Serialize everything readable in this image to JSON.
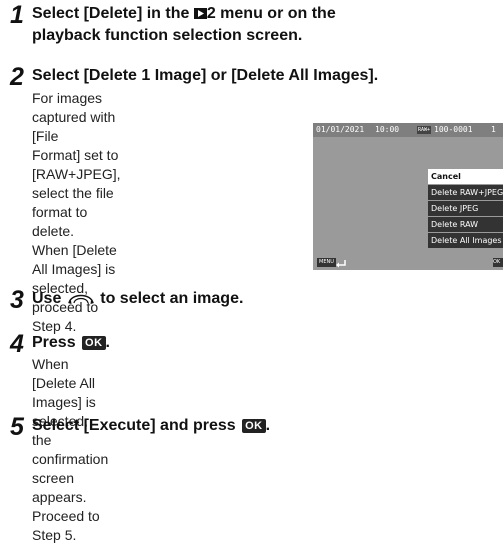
{
  "steps": [
    {
      "number": "1",
      "title_line1_a": "Select [Delete] in the ",
      "title_line1_b": "2 menu or on the",
      "title_line2": "playback function selection screen."
    },
    {
      "number": "2",
      "title": "Select [Delete 1 Image] or [Delete All Images].",
      "body": [
        "For images captured with [File",
        "Format] set to [RAW+JPEG],",
        "select the file format to delete.",
        "When [Delete All Images] is",
        "selected, proceed to Step 4."
      ]
    },
    {
      "number": "3",
      "title_a": "Use ",
      "title_b": " to select an image."
    },
    {
      "number": "4",
      "title": "Press ",
      "ok": "OK",
      "title_end": ".",
      "body": [
        "When [Delete All Images] is selected, the confirmation",
        "screen appears. Proceed to Step 5."
      ]
    },
    {
      "number": "5",
      "title": "Select [Execute] and press ",
      "ok": "OK",
      "title_end": "."
    }
  ],
  "screen": {
    "date": "01/01/2021",
    "time": "10:00",
    "file_badge": "RAW+",
    "file_number": "100-0001",
    "counter": "1",
    "menu": [
      "Cancel",
      "Delete RAW+JPEG",
      "Delete JPEG",
      "Delete RAW",
      "Delete All Images"
    ],
    "menu_button": "MENU",
    "ok_button": "OK"
  },
  "icons": {
    "playback_menu": "playback-icon",
    "dial": "dial-icon",
    "back": "back-arrow-icon"
  }
}
